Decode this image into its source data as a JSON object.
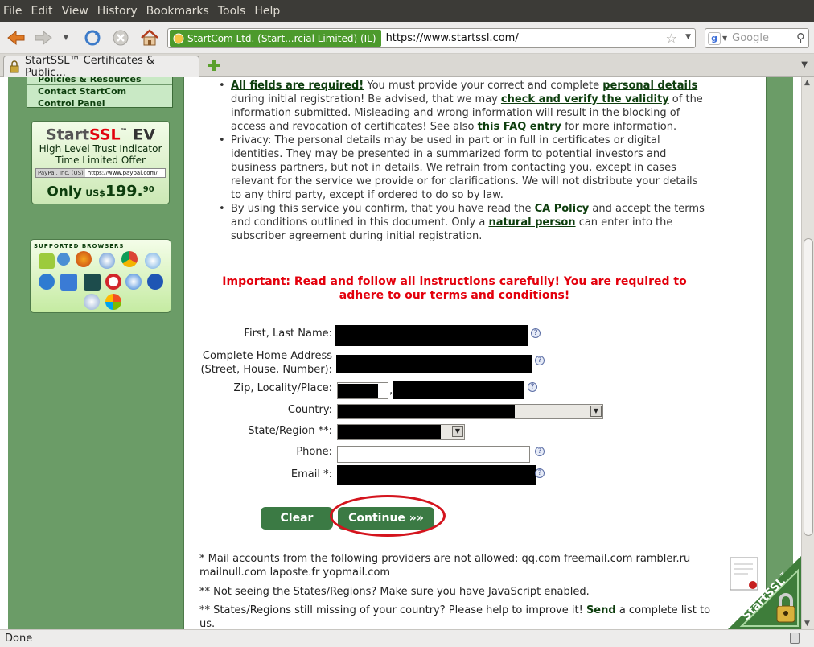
{
  "menubar": {
    "items": [
      "File",
      "Edit",
      "View",
      "History",
      "Bookmarks",
      "Tools",
      "Help"
    ]
  },
  "navbar": {
    "identity_label": "StartCom Ltd. (Start...rcial Limited) (IL)",
    "url": "https://www.startssl.com/",
    "search_placeholder": "Google"
  },
  "tab": {
    "title": "StartSSL™ Certificates & Public..."
  },
  "sidebar": {
    "nav_items": [
      "Policies & Resources",
      "Contact StartCom",
      "Control Panel"
    ],
    "ev": {
      "title_start": "Start",
      "title_ssl": "SSL",
      "title_tm": "™",
      "title_ev": "EV",
      "line1": "High Level Trust Indicator",
      "line2": "Time Limited Offer",
      "paypal": "PayPal, Inc. (US)",
      "paypal_url": "https://www.paypal.com/",
      "only": "Only",
      "currency": "US$",
      "price": "199.",
      "cents": "90"
    },
    "browsers_title": "SUPPORTED BROWSERS"
  },
  "terms": {
    "b1": {
      "link1": "All fields are required!",
      "t1": " You must provide your correct and complete ",
      "link2": "personal details",
      "t2": " during initial registration! Be advised, that we may ",
      "link3": "check and verify the validity",
      "t3": " of the information submitted. Misleading and wrong information will result in the blocking of access and revocation of certificates! See also ",
      "link4": "this FAQ entry",
      "t4": " for more information."
    },
    "b2": "Privacy: The personal details may be used in part or in full in certificates or digital identities. They may be presented in a summarized form to potential investors and business partners, but not in details. We refrain from contacting you, except in cases relevant for the service we provide or for clarifications. We will not distribute your details to any third party, except if ordered to do so by law.",
    "b3": {
      "t1": "By using this service you confirm, that you have read the ",
      "link1": "CA Policy",
      "t2": " and accept the terms and conditions outlined in this document. Only a ",
      "link2": "natural person",
      "t3": " can enter into the subscriber agreement during initial registration."
    }
  },
  "important": "Important: Read and follow all instructions carefully! You are required to adhere to our terms and conditions!",
  "form": {
    "name_label": "First, Last Name:",
    "address_label_1": "Complete Home Address",
    "address_label_2": "(Street, House, Number):",
    "zip_label": "Zip, Locality/Place:",
    "zip_sep": ",",
    "country_label": "Country:",
    "state_label": "State/Region **:",
    "phone_label": "Phone:",
    "email_label": "Email *:",
    "help": "?"
  },
  "buttons": {
    "clear": "Clear",
    "continue": "Continue »»"
  },
  "notes": {
    "n1": "* Mail accounts from the following providers are not allowed: qq.com freemail.com rambler.ru mailnull.com laposte.fr yopmail.com",
    "n2": "** Not seeing the States/Regions? Make sure you have JavaScript enabled.",
    "n3a": "** States/Regions still missing of your country? Please help to improve it! ",
    "n3link": "Send",
    "n3b": " a complete list to us."
  },
  "seal": {
    "text": "StartSSL",
    "tm": "™"
  },
  "status": "Done",
  "colors": {
    "accent_green": "#3b7a44",
    "sidebar_green": "#6b9c67",
    "warning_red": "#e3000c",
    "identity_green": "#4c9a2c"
  }
}
